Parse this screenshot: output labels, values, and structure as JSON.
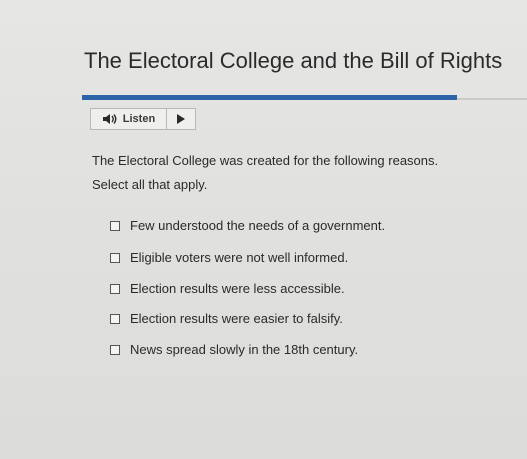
{
  "header": {
    "title": "The Electoral College and the Bill of Rights"
  },
  "listen": {
    "label": "Listen",
    "speaker_icon": "speaker-icon",
    "play_icon": "play-icon"
  },
  "question": {
    "prompt": "The Electoral College was created for the following reasons.",
    "instruction": "Select all that apply.",
    "options": [
      {
        "label": "Few understood the needs of a government.",
        "checked": false
      },
      {
        "label": "Eligible voters were not well informed.",
        "checked": false
      },
      {
        "label": "Election results were less accessible.",
        "checked": false
      },
      {
        "label": "Election results were easier to falsify.",
        "checked": false
      },
      {
        "label": "News spread slowly in the 18th century.",
        "checked": false
      }
    ]
  },
  "colors": {
    "accent_rule": "#2c63a9",
    "background": "#e4e4e2"
  }
}
